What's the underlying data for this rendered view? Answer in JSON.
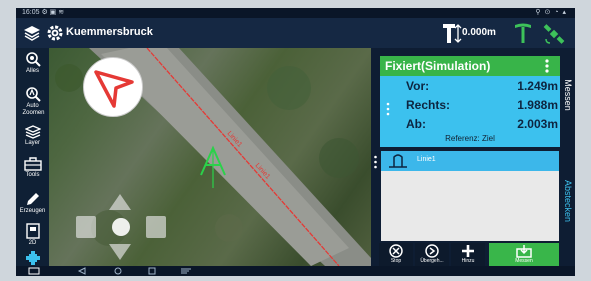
{
  "status_bar": {
    "time": "16:05 ⚙ ▣ ≋",
    "indicators": "⚲ ⊙ ◔ ▴"
  },
  "app_bar": {
    "project_name": "Kuemmersbruck",
    "height_value": "0.000m",
    "icons": [
      "layers-icon",
      "gear-icon",
      "antenna-height-icon",
      "survey-pole-icon",
      "satellite-icon"
    ]
  },
  "sidebar": {
    "items": [
      {
        "label": "Alles",
        "icon": "zoom-all-icon"
      },
      {
        "label": "Auto Zoomen",
        "icon": "auto-zoom-icon"
      },
      {
        "label": "Layer",
        "icon": "layer-icon"
      },
      {
        "label": "Tools",
        "icon": "toolbox-icon"
      },
      {
        "label": "Erzeugen",
        "icon": "pencil-icon"
      },
      {
        "label": "2D",
        "icon": "view-2d-icon"
      },
      {
        "label": "",
        "icon": "move-icon"
      }
    ]
  },
  "map": {
    "line_labels": [
      "Linie1",
      "Linie1"
    ],
    "target_marker": "A"
  },
  "info_card": {
    "title": "Fixiert(Simulation)",
    "rows": [
      {
        "key": "Vor:",
        "value": "1.249m"
      },
      {
        "key": "Rechts:",
        "value": "1.988m"
      },
      {
        "key": "Ab:",
        "value": "2.003m"
      }
    ],
    "reference": "Referenz: Ziel"
  },
  "line_list": {
    "items": [
      {
        "name": "Linie1"
      }
    ]
  },
  "toolbar": {
    "buttons": [
      {
        "label": "Stop",
        "icon": "stop-icon"
      },
      {
        "label": "Übergeh...",
        "icon": "skip-icon"
      },
      {
        "label": "Hinzu",
        "icon": "plus-icon"
      },
      {
        "label": "Messen",
        "icon": "measure-icon"
      }
    ]
  },
  "side_tabs": {
    "measure": "Messen",
    "stakeout": "Abstecken"
  },
  "colors": {
    "accent_green": "#38b449",
    "accent_cyan": "#3cc1ee",
    "line_red": "#e53935",
    "dark_bg": "#0e1d33"
  }
}
